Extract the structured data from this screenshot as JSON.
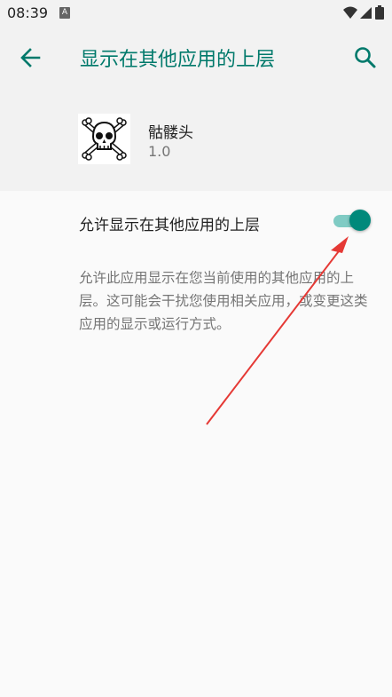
{
  "status_bar": {
    "time": "08:39",
    "notification_glyph": "A",
    "icons": [
      "wifi-icon",
      "signal-icon",
      "battery-icon"
    ]
  },
  "toolbar": {
    "title": "显示在其他应用的上层",
    "back_icon": "arrow-left-icon",
    "search_icon": "search-icon"
  },
  "app": {
    "name": "骷髅头",
    "version": "1.0",
    "icon": "skull-crossbones-icon"
  },
  "permission": {
    "label": "允许显示在其他应用的上层",
    "enabled": true,
    "description": "允许此应用显示在您当前使用的其他应用的上层。这可能会干扰您使用相关应用，或变更这类应用的显示或运行方式。"
  },
  "colors": {
    "accent": "#00796b",
    "toggle_thumb": "#00897b",
    "toggle_track": "#80cbc4",
    "annotation_arrow": "#e53935"
  }
}
